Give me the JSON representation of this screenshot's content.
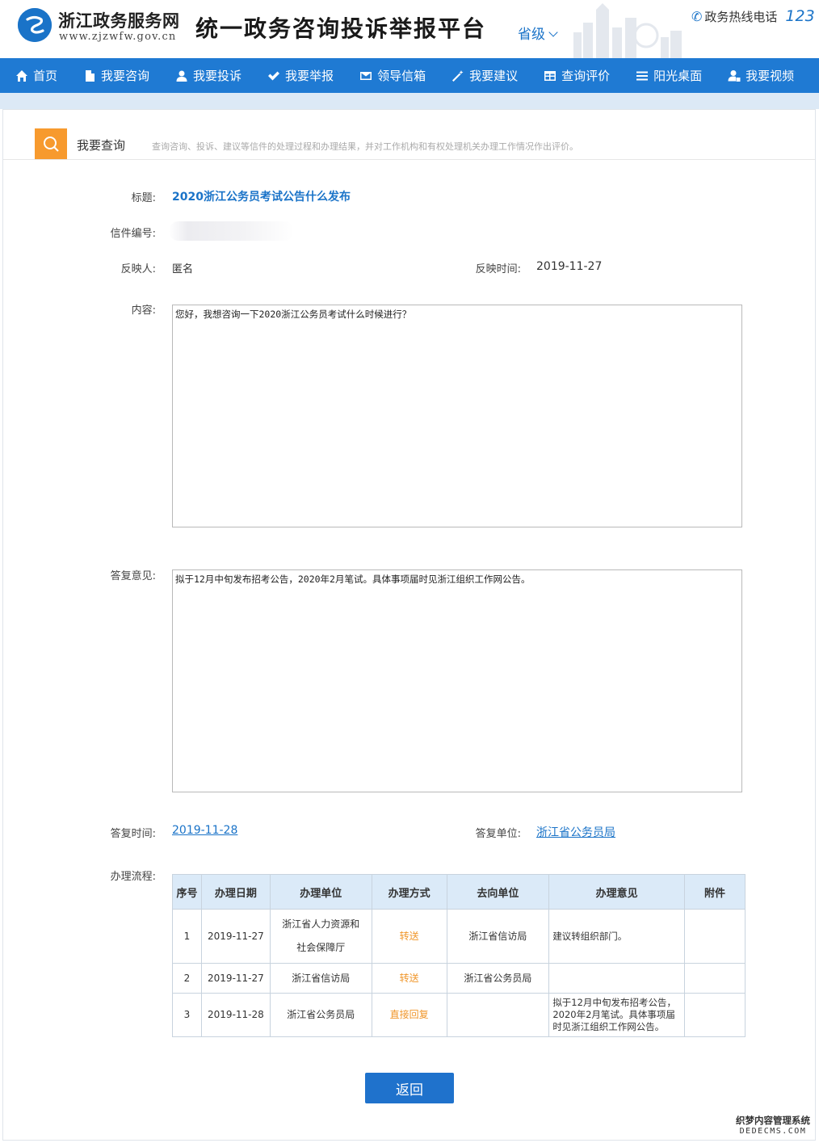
{
  "header": {
    "site_name": "浙江政务服务网",
    "site_url": "www.zjzwfw.gov.cn",
    "platform_title": "统一政务咨询投诉举报平台",
    "level": "省级",
    "hotline_label": "政务热线电话",
    "hotline_number": "123"
  },
  "nav": [
    {
      "label": "首页",
      "icon": "home-icon"
    },
    {
      "label": "我要咨询",
      "icon": "file-icon"
    },
    {
      "label": "我要投诉",
      "icon": "user-icon"
    },
    {
      "label": "我要举报",
      "icon": "check-icon"
    },
    {
      "label": "领导信箱",
      "icon": "envelope-icon"
    },
    {
      "label": "我要建议",
      "icon": "magic-wand-icon"
    },
    {
      "label": "查询评价",
      "icon": "table-icon"
    },
    {
      "label": "阳光桌面",
      "icon": "menu-icon"
    },
    {
      "label": "我要视频",
      "icon": "user-lock-icon"
    }
  ],
  "section": {
    "title": "我要查询",
    "description": "查询咨询、投诉、建议等信件的处理过程和办理结果，并对工作机构和有权处理机关办理工作情况作出评价。"
  },
  "detail": {
    "title_label": "标题:",
    "title_value": "2020浙江公务员考试公告什么发布",
    "letter_no_label": "信件编号:",
    "reporter_label": "反映人:",
    "reporter_value": "匿名",
    "report_time_label": "反映时间:",
    "report_time_value": "2019-11-27",
    "content_label": "内容:",
    "content_value": "您好，我想咨询一下2020浙江公务员考试什么时候进行？",
    "reply_label": "答复意见:",
    "reply_value": "拟于12月中旬发布招考公告，2020年2月笔试。具体事项届时见浙江组织工作网公告。",
    "reply_time_label": "答复时间:",
    "reply_time_value": "2019-11-28",
    "reply_unit_label": "答复单位:",
    "reply_unit_value": "浙江省公务员局",
    "flow_label": "办理流程:"
  },
  "flow_table": {
    "headers": [
      "序号",
      "办理日期",
      "办理单位",
      "办理方式",
      "去向单位",
      "办理意见",
      "附件"
    ],
    "rows": [
      {
        "no": "1",
        "date": "2019-11-27",
        "unit_line1": "浙江省人力资源和",
        "unit_line2": "社会保障厅",
        "method": "转送",
        "dest": "浙江省信访局",
        "opinion": "建议转组织部门。",
        "attach": ""
      },
      {
        "no": "2",
        "date": "2019-11-27",
        "unit_line1": "浙江省信访局",
        "unit_line2": "",
        "method": "转送",
        "dest": "浙江省公务员局",
        "opinion": "",
        "attach": ""
      },
      {
        "no": "3",
        "date": "2019-11-28",
        "unit_line1": "浙江省公务员局",
        "unit_line2": "",
        "method": "直接回复",
        "dest": "",
        "opinion": "拟于12月中旬发布招考公告，2020年2月笔试。具体事项届时见浙江组织工作网公告。",
        "attach": ""
      }
    ]
  },
  "back_button": "返回",
  "watermark": {
    "line1": "织梦内容管理系统",
    "line2": "DEDECMS.COM"
  },
  "colors": {
    "primary": "#1f7ad3",
    "accent": "#f79a2e",
    "link": "#1a73c8",
    "method": "#f0962a"
  }
}
